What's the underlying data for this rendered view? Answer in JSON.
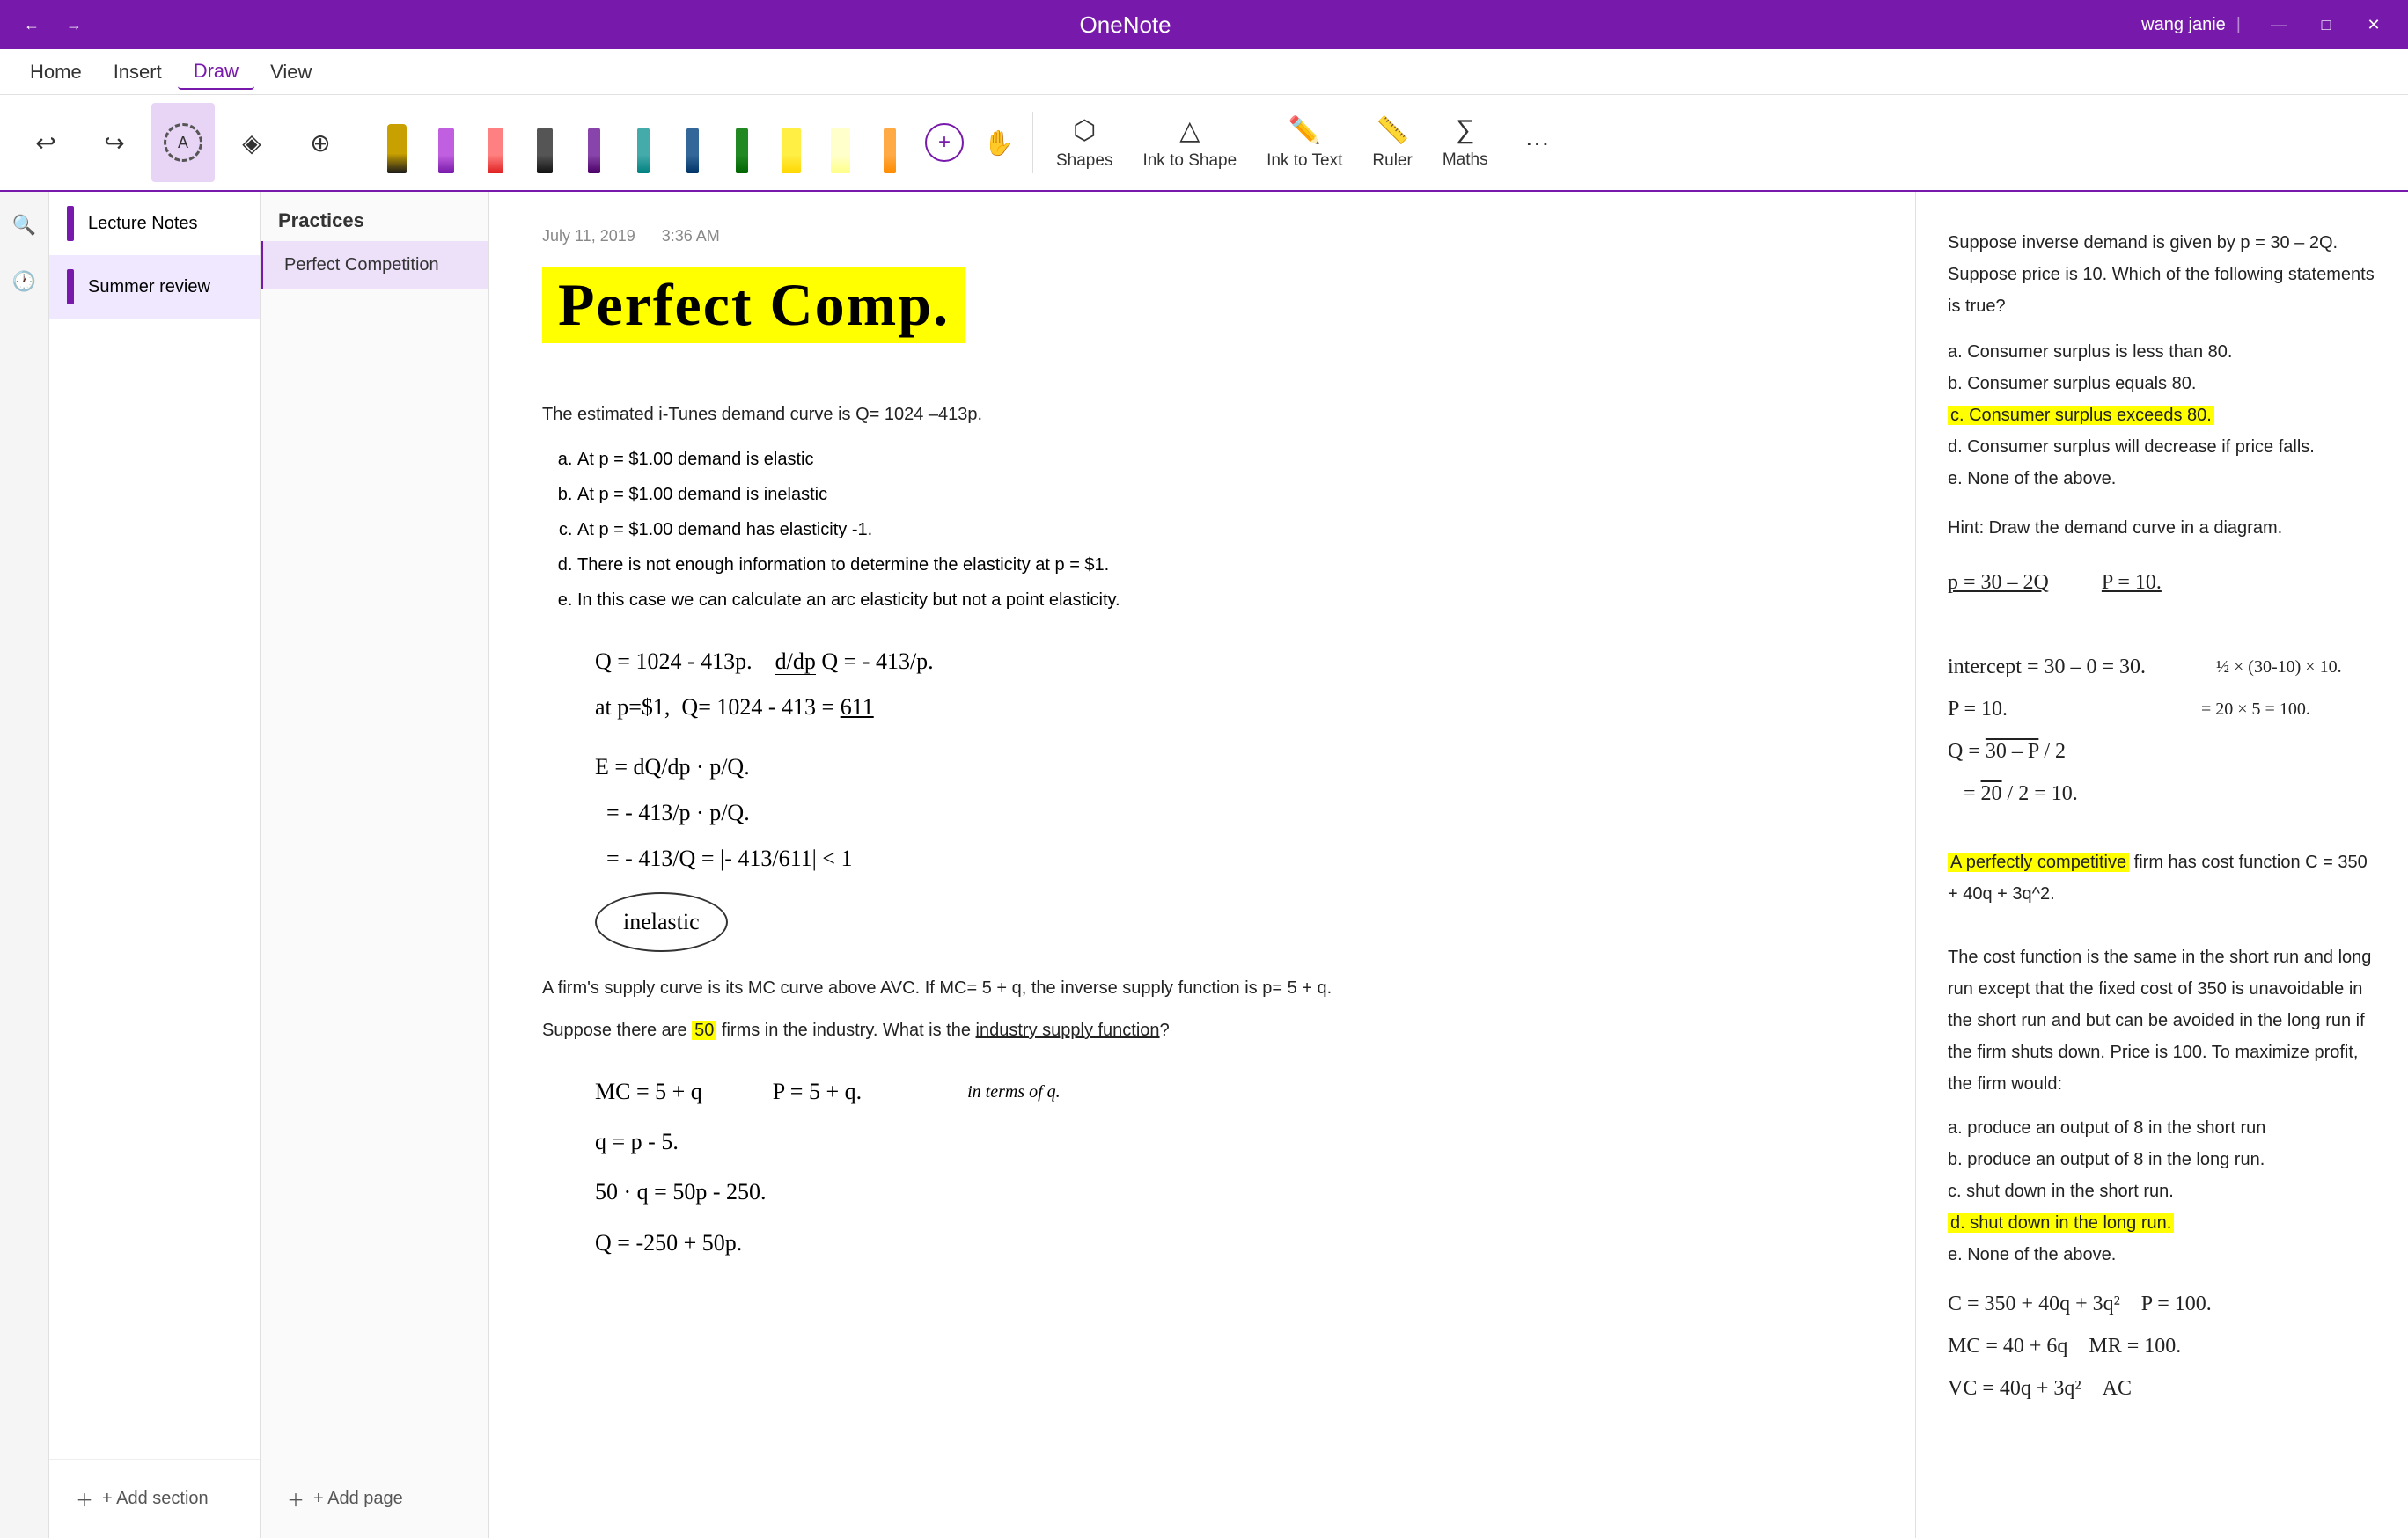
{
  "app": {
    "title": "OneNote",
    "user": "wang janie"
  },
  "titlebar": {
    "back_label": "←",
    "forward_label": "→",
    "minimize": "—",
    "maximize": "□",
    "close": "✕"
  },
  "menu": {
    "items": [
      "Home",
      "Insert",
      "Draw",
      "View"
    ]
  },
  "toolbar": {
    "lasso_label": "Lasso",
    "eraser_label": "Eraser",
    "shapes_label": "Shapes",
    "ink_to_shape_label": "Ink to Shape",
    "ink_to_text_label": "Ink to Text",
    "ruler_label": "Ruler",
    "maths_label": "Maths",
    "insert_plus": "+",
    "hand_icon": "✋"
  },
  "sidebar": {
    "search_icon": "🔍",
    "recent_icon": "🕐"
  },
  "sections": {
    "items": [
      {
        "label": "Lecture Notes",
        "active": false
      },
      {
        "label": "Summer review",
        "active": true
      }
    ],
    "add_section": "+ Add section"
  },
  "pages": {
    "section_header": "Practices",
    "items": [
      {
        "label": "Perfect Competition",
        "active": true
      }
    ],
    "add_page": "+ Add page"
  },
  "content": {
    "date": "July 11, 2019",
    "time": "3:36 AM",
    "title": "Perfect Comp.",
    "question1_text": "The estimated i-Tunes demand curve is Q= 1024 –413p.",
    "question1_options": [
      "At p = $1.00 demand is elastic",
      "At p = $1.00 demand is inelastic",
      "At p = $1.00 demand has elasticity -1.",
      "There is not enough information to determine the elasticity at p = $1.",
      "In this case we can calculate an arc elasticity but not a point elasticity."
    ],
    "question2_text": "A firm's supply curve is its MC curve above AVC. If MC= 5 + q, the inverse supply function is p= 5 + q.",
    "question2_text2": "Suppose there are 50 firms in the industry. What is the industry supply function?"
  },
  "right_panel": {
    "question_text": "Suppose inverse demand is given by p = 30 – 2Q. Suppose price is 10. Which of the following statements is true?",
    "options": [
      "a. Consumer surplus is less than 80.",
      "b. Consumer surplus equals 80.",
      "c. Consumer surplus exceeds 80.",
      "d. Consumer surplus will decrease if price falls.",
      "e. None of the above."
    ],
    "hint": "Hint: Draw the demand curve in a diagram.",
    "answer_c_highlighted": "c. Consumer surplus exceeds 80.",
    "math1": "p = 30 – 2Q    P = 10.",
    "math2": "intercept = 30 – 0 = 30.",
    "math3": "P = 10.",
    "math4": "Q = 30 – P / 2",
    "math5": "= 20 / 2 = 10.",
    "math6": "½ × (30-10) × 10.",
    "math7": "= 20 × 5 = 100.",
    "question2_intro": "A perfectly competitive firm has cost function C = 350 + 40q + 3q^2.",
    "question2_body": "The cost function is the same in the short run and long run except that the fixed cost of 350 is unavoidable in the short run and but can be avoided in the long run if the firm shuts down. Price is 100. To maximize profit, the firm would:",
    "question2_options": [
      "a. produce an output of 8 in the short run",
      "b. produce an output of 8 in the long run.",
      "c. shut down in the short run.",
      "d. shut down in the long run.",
      "e. None of the above."
    ],
    "answer_d_highlighted": "d. shut down in the long run.",
    "math_cost": "C = 350 + 40q + 3q²    P = 100.",
    "math_mc": "MC = 40 + 6q    MR = 100.",
    "math_vc": "VC = 40q + 3q²    AC"
  },
  "pens": [
    {
      "color": "#1a1a1a",
      "name": "black-pen"
    },
    {
      "color": "#7719aa",
      "name": "purple-pen"
    },
    {
      "color": "#e02020",
      "name": "red-pen"
    },
    {
      "color": "#222222",
      "name": "dark-pen"
    },
    {
      "color": "#4a0066",
      "name": "dark-purple-pen"
    },
    {
      "color": "#008080",
      "name": "teal-pen"
    },
    {
      "color": "#003366",
      "name": "dark-blue-pen"
    },
    {
      "color": "#006400",
      "name": "dark-green-pen"
    },
    {
      "color": "#ffd700",
      "name": "yellow-highlighter"
    },
    {
      "color": "#ffff88",
      "name": "light-yellow-highlighter"
    },
    {
      "color": "#ff8c00",
      "name": "orange-pen"
    }
  ]
}
